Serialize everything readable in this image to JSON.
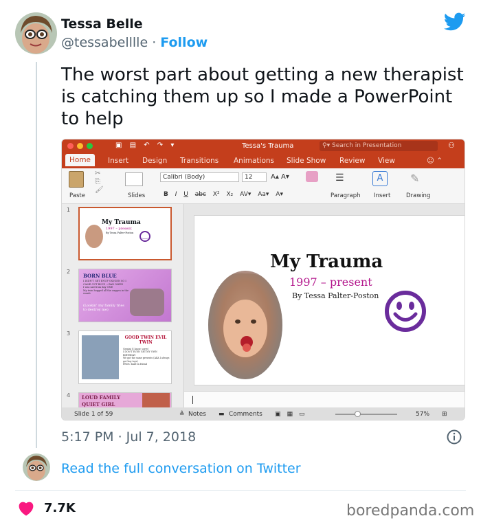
{
  "tweet": {
    "author_name": "Tessa Belle",
    "author_handle": "@tessabelllle",
    "separator": "·",
    "follow_label": "Follow",
    "text": "The worst part about getting a new therapist is catching them up so I made a PowerPoint to help",
    "timestamp": "5:17 PM · Jul 7, 2018",
    "read_more_label": "Read the full conversation on Twitter",
    "like_count": "7.7K",
    "icons": [
      "twitter-bird-icon",
      "info-icon",
      "heart-icon"
    ],
    "colors": {
      "accent": "#1d9bf0",
      "like": "#f91880",
      "secondary_text": "#536471"
    }
  },
  "watermark": "boredpanda.com",
  "ppt": {
    "window_title": "Tessa's Trauma",
    "search_placeholder": "Search in Presentation",
    "tabs": [
      "Home",
      "Insert",
      "Design",
      "Transitions",
      "Animations",
      "Slide Show",
      "Review",
      "View"
    ],
    "active_tab": "Home",
    "ribbon": {
      "paste": "Paste",
      "slides": "Slides",
      "font": "Calibri (Body)",
      "size": "12",
      "paragraph": "Paragraph",
      "insert": "Insert",
      "drawing": "Drawing",
      "format_buttons": [
        "B",
        "I",
        "U",
        "abc",
        "X²",
        "X₂"
      ]
    },
    "thumbnails": [
      {
        "num": "1",
        "title": "My Trauma",
        "sub": "1997 – present",
        "by": "By Tessa Palter-Poston"
      },
      {
        "num": "2",
        "title": "BORN BLUE",
        "bullets": [
          "I DIDN'T GET ENUF OXYGEN SO I CAME OUT BLUE → BAD OMEN",
          "I was sad from day ONE",
          "My twin hogged all the oxygen in the womb"
        ],
        "caption": "(Lookin' my family tries to destroy me)"
      },
      {
        "num": "3",
        "title": "GOOD TWIN EVIL TWIN",
        "bullets": [
          "Gemini (I know, sorry)",
          "I DON'T EVEN GET MY OWN BIRTHDAY",
          "We got the same presents (AKA I always got boy toys)",
          "PROS: built-in friend"
        ]
      },
      {
        "num": "4",
        "title": "LOUD FAMILY QUIET GIRL"
      }
    ],
    "slide": {
      "title": "My Trauma",
      "subtitle": "1997 – present",
      "byline": "By Tessa Palter-Poston"
    },
    "status": {
      "slide_count": "Slide 1 of 59",
      "notes": "Notes",
      "comments": "Comments",
      "zoom": "57%"
    },
    "colors": {
      "brand": "#c43e1c",
      "subtitle": "#b3178c",
      "smiley": "#6a2c9c"
    }
  }
}
